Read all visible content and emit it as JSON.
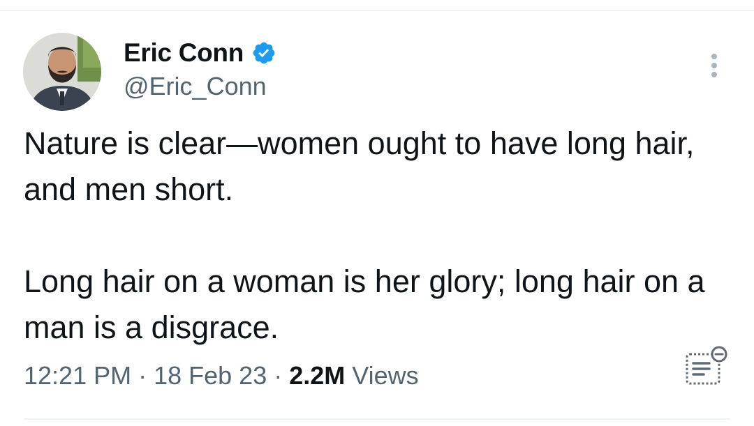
{
  "tweet": {
    "author": {
      "display_name": "Eric Conn",
      "handle": "@Eric_Conn",
      "verified": true,
      "verified_icon": "verified-badge-icon",
      "avatar": "profile-photo"
    },
    "text_paragraphs": [
      "Nature is clear—women ought to have long hair, and men short.",
      "Long hair on a woman is her glory; long hair on a man is a disgrace."
    ],
    "meta": {
      "time": "12:21 PM",
      "separator": "·",
      "date": "18 Feb 23",
      "views_count": "2.2M",
      "views_label": "Views"
    },
    "actions": {
      "more_icon": "more-vertical-icon",
      "reader_icon": "reader-mode-icon"
    },
    "colors": {
      "text_primary": "#0f1419",
      "text_secondary": "#536471",
      "verified_blue": "#1d9bf0",
      "divider": "#eff3f4"
    }
  }
}
